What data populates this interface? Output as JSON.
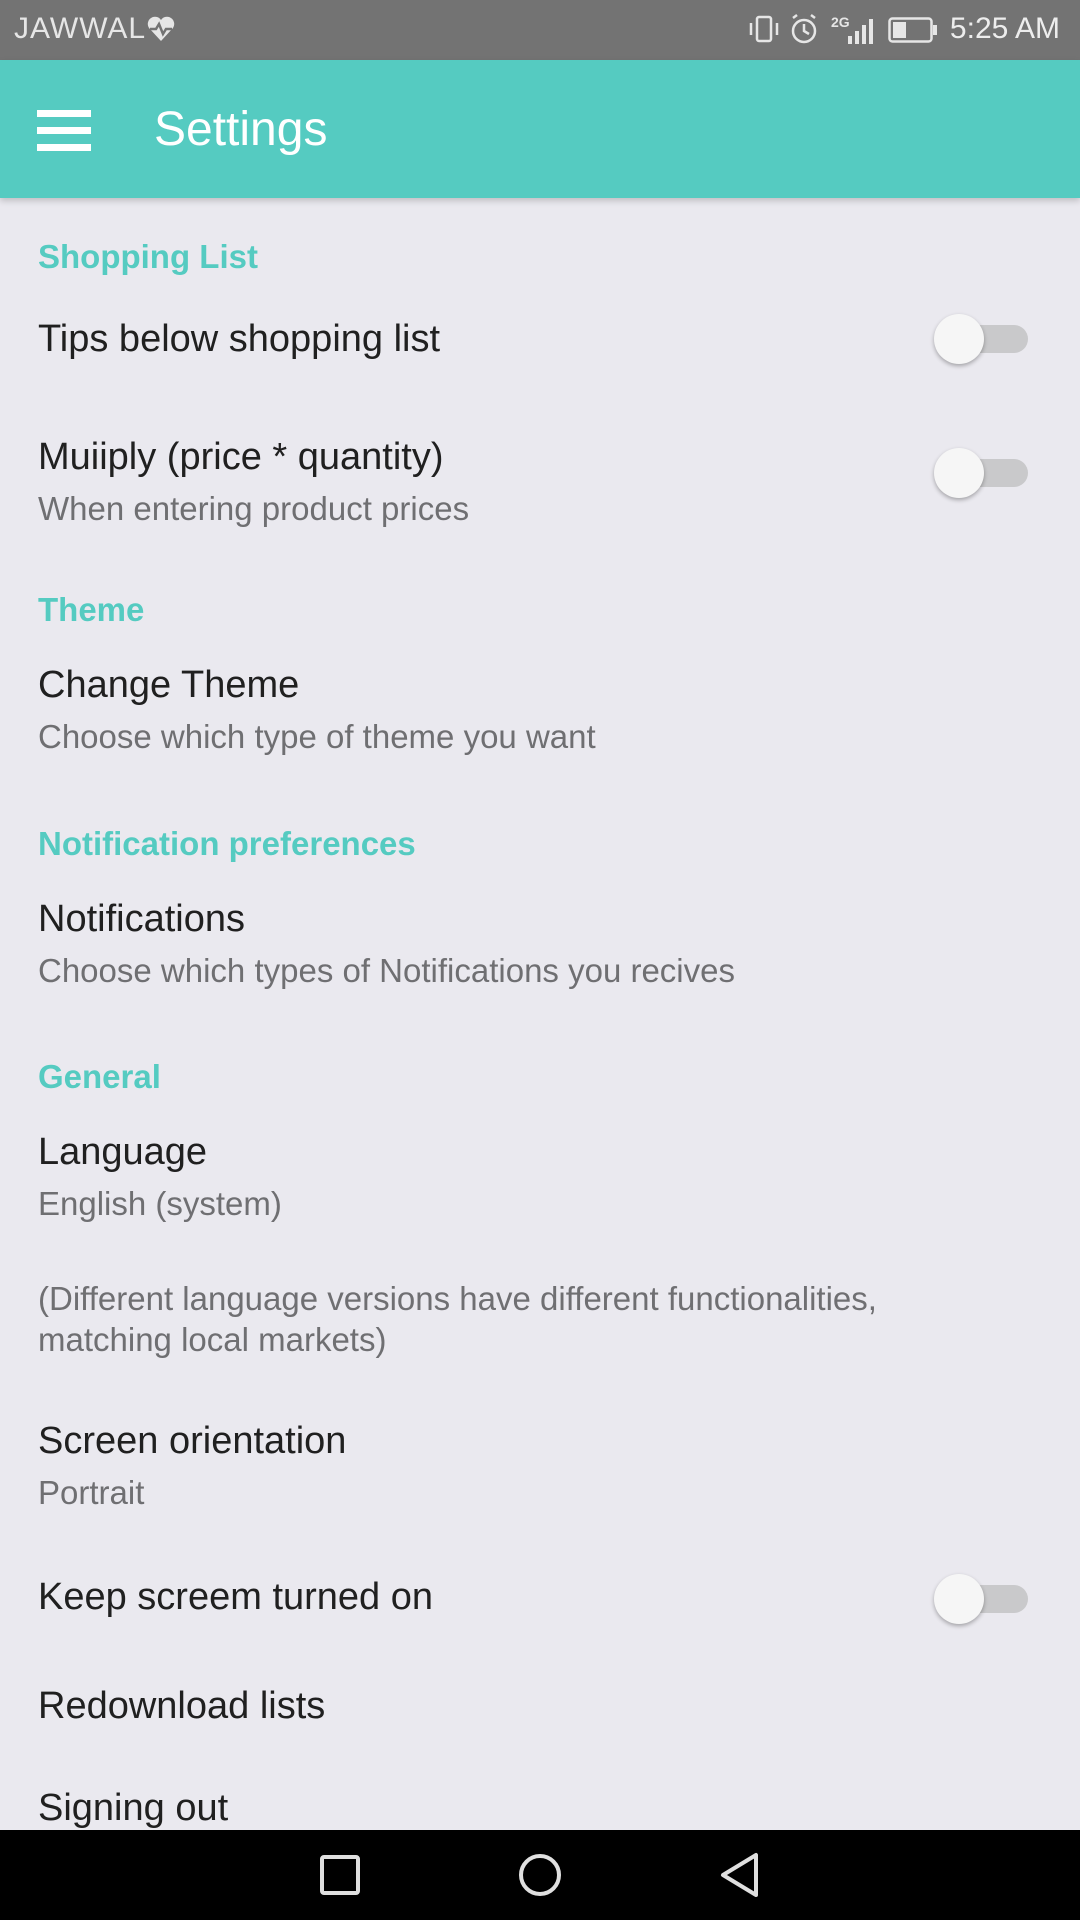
{
  "status_bar": {
    "carrier": "JAWWAL",
    "carrier_icon": "heart-pulse-icon",
    "network": "2G",
    "time": "5:25 AM",
    "icons": [
      "vibrate-icon",
      "alarm-icon",
      "signal-icon",
      "battery-icon"
    ]
  },
  "app_bar": {
    "title": "Settings",
    "menu_icon": "hamburger-menu-icon"
  },
  "sections": {
    "shopping_list": {
      "header": "Shopping List",
      "tips": {
        "title": "Tips below shopping list",
        "enabled": false
      },
      "multiply": {
        "title": "Muiiply (price * quantity)",
        "summary": "When entering product prices",
        "enabled": false
      }
    },
    "theme": {
      "header": "Theme",
      "change_theme": {
        "title": "Change Theme",
        "summary": "Choose which type of theme you want"
      }
    },
    "notifications": {
      "header": "Notification preferences",
      "notifications": {
        "title": "Notifications",
        "summary": "Choose which types of Notifications you recives"
      }
    },
    "general": {
      "header": "General",
      "language": {
        "title": "Language",
        "summary": "English (system)"
      },
      "language_note": "(Different language versions have different functionalities, matching local markets)",
      "orientation": {
        "title": "Screen orientation",
        "summary": "Portrait"
      },
      "keep_screen": {
        "title": "Keep screem turned on",
        "enabled": false
      },
      "redownload": {
        "title": "Redownload lists"
      },
      "signing_out": {
        "title": "Signing out"
      }
    }
  },
  "nav_bar": {
    "buttons": [
      "recent-apps-icon",
      "home-icon",
      "back-icon"
    ]
  },
  "colors": {
    "accent": "#55CBC1",
    "background": "#EAE9EF",
    "status_bar": "#737373",
    "nav_bar": "#000000"
  }
}
